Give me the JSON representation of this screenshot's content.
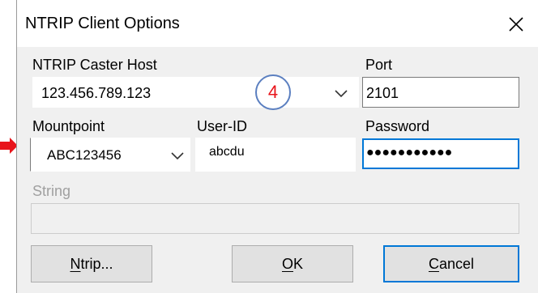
{
  "dialog": {
    "title": "NTRIP Client Options",
    "close_icon": "close-icon"
  },
  "caster_host": {
    "label": "NTRIP Caster Host",
    "value": "123.456.789.123"
  },
  "port": {
    "label": "Port",
    "value": "2101"
  },
  "mountpoint": {
    "label": "Mountpoint",
    "value": "ABC123456"
  },
  "user_id": {
    "label": "User-ID",
    "value": "abcdu"
  },
  "password": {
    "label": "Password",
    "value": "●●●●●●●●●●●"
  },
  "string_field": {
    "label": "String",
    "value": ""
  },
  "buttons": {
    "ntrip": {
      "mnemonic": "N",
      "rest": "trip..."
    },
    "ok": {
      "mnemonic": "O",
      "rest": "K"
    },
    "cancel": {
      "mnemonic": "C",
      "rest": "ancel"
    }
  },
  "annotation": {
    "badge_text": "4",
    "badge_color": "#e8141b",
    "badge_border": "#5b7fc0",
    "arrow_color": "#e8141b"
  },
  "colors": {
    "focus_border": "#0078d7",
    "dialog_bg": "#f0f0f0"
  }
}
